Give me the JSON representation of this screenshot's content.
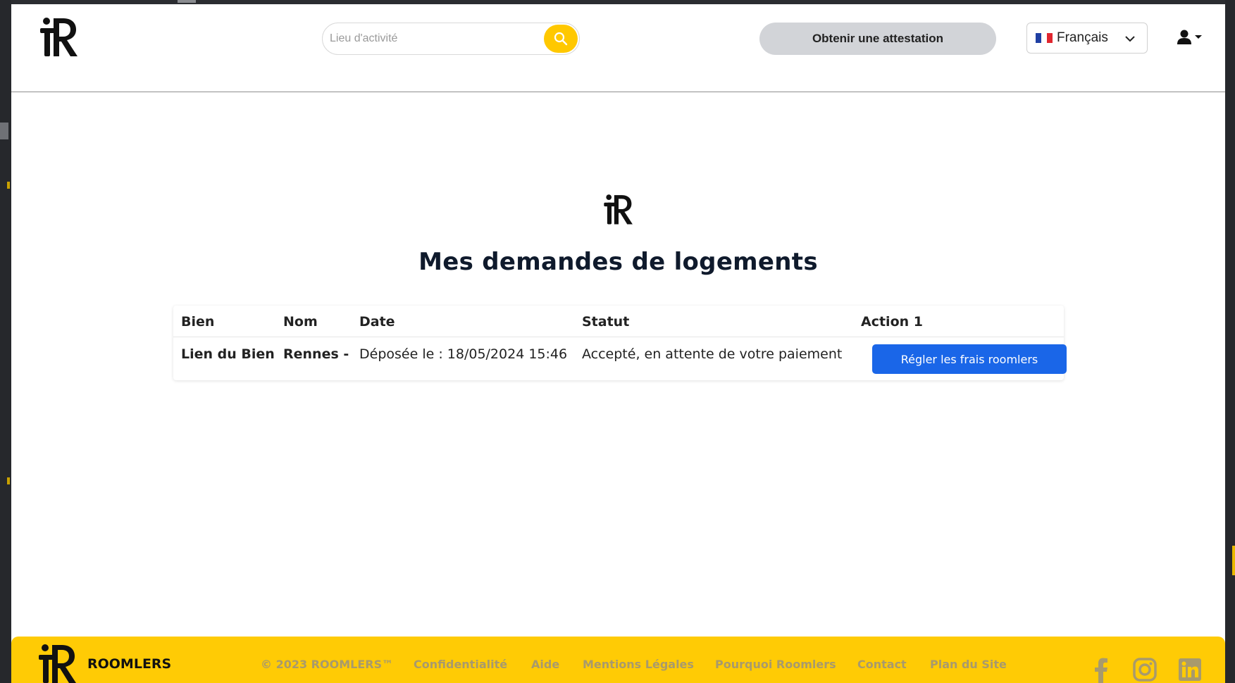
{
  "header": {
    "search": {
      "placeholder": "Lieu d'activité",
      "value": ""
    },
    "attestation_button": "Obtenir une attestation",
    "language": {
      "selected": "Français",
      "flag_colors": [
        "#1f3fa3",
        "#ffffff",
        "#e0262f"
      ]
    }
  },
  "main": {
    "title": "Mes demandes de logements",
    "table": {
      "columns": [
        "Bien",
        "Nom",
        "Date",
        "Statut",
        "Action 1"
      ],
      "rows": [
        {
          "bien": "Lien du Bien",
          "nom": "Rennes -",
          "date": "Déposée le : 18/05/2024 15:46",
          "statut": "Accepté, en attente de votre paiement",
          "action": "Régler les frais roomlers"
        }
      ]
    }
  },
  "footer": {
    "brand": "ROOMLERS",
    "links": [
      "© 2023 ROOMLERS™",
      "Confidentialité",
      "Aide",
      "Mentions Légales",
      "Pourquoi Roomlers",
      "Contact",
      "Plan du Site"
    ],
    "social": [
      "facebook-icon",
      "instagram-icon",
      "linkedin-icon"
    ]
  },
  "colors": {
    "accent_yellow": "#ffc800",
    "primary_blue": "#1a66e8",
    "title_dark": "#0f1a2c"
  }
}
